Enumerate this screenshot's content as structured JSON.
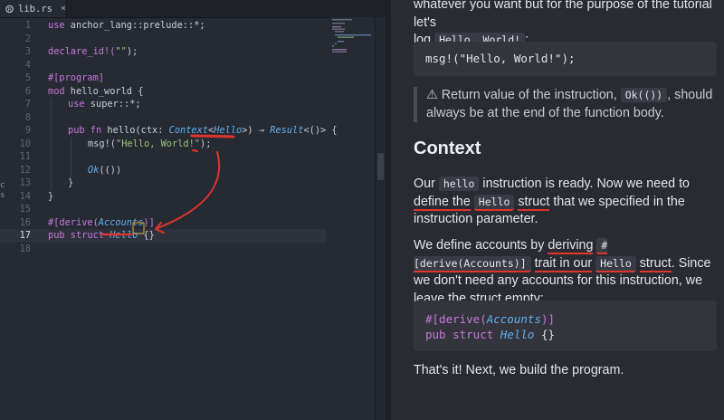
{
  "tab": {
    "filename": "lib.rs",
    "close": "×"
  },
  "left_edge": [
    "c",
    "s"
  ],
  "code": {
    "l1": {
      "n": "1",
      "a": "use",
      "b": " anchor_lang::prelude::*;"
    },
    "l3": {
      "n": "3",
      "a": "declare_id!(",
      "b": "\"\"",
      "c": ");"
    },
    "l5": {
      "n": "5",
      "a": "#[program]"
    },
    "l6": {
      "n": "6",
      "a": "mod",
      "b": " hello_world {"
    },
    "l7": {
      "n": "7",
      "a": "use",
      "b": " super::*;"
    },
    "l9": {
      "n": "9",
      "a": "pub",
      "b": " fn",
      "c": " hello(ctx: ",
      "d": "Context",
      "e": "<",
      "f": "Hello",
      "g": ">) → ",
      "h": "Result",
      "i": "<()> {"
    },
    "l10": {
      "n": "10",
      "a": "msg!(",
      "b": "\"Hello, World!\"",
      "c": ");"
    },
    "l12": {
      "n": "12",
      "a": "Ok",
      "b": "(())"
    },
    "l13": {
      "n": "13",
      "a": "}"
    },
    "l14": {
      "n": "14",
      "a": "}"
    },
    "l16": {
      "n": "16",
      "a": "#[derive(",
      "b": "Accounts",
      "c": ")]"
    },
    "l17": {
      "n": "17",
      "a": "pub",
      "b": " struct",
      "c": " ",
      "d": "Hello",
      "e": " {}"
    },
    "empty_lines": [
      "2",
      "4",
      "8",
      "11",
      "15",
      "18"
    ]
  },
  "docs": {
    "intro_line1": "whatever you want but for the purpose of the tutorial let's",
    "intro_line2_pre": "log ",
    "intro_code": "Hello, World!",
    "intro_line2_post": ":",
    "block1": "msg!(\"Hello, World!\");",
    "note_icon": "⚠",
    "note_pre": " Return value of the instruction, ",
    "note_code": "Ok(())",
    "note_post": ", should always be at the end of the function body.",
    "heading": "Context",
    "p1_a": "Our ",
    "p1_code1": "hello",
    "p1_b": " instruction is ready. Now we need to ",
    "p1_u1": "define the",
    "p1_code2": "Hello",
    "p1_u2": "struct",
    "p1_c": " that we specified in the instruction parameter.",
    "p2_a": "We define accounts by ",
    "p2_u1": "deriving",
    "p2_code1": "#[derive(Accounts)]",
    "p2_u2": "trait in our",
    "p2_code2": "Hello",
    "p2_u3": "struct",
    "p2_b": ". Since we don't need any accounts for this instruction, we leave the struct empty:",
    "block2_l1_a": "#[derive(",
    "block2_l1_b": "Accounts",
    "block2_l1_c": ")]",
    "block2_l2_a": "pub struct ",
    "block2_l2_b": "Hello",
    "block2_l2_c": " {}",
    "outro": "That's it! Next, we build the program."
  },
  "colors": {
    "annotation": "#e0352b",
    "keyword": "#c678dd",
    "type": "#61afef",
    "string": "#98c379"
  }
}
